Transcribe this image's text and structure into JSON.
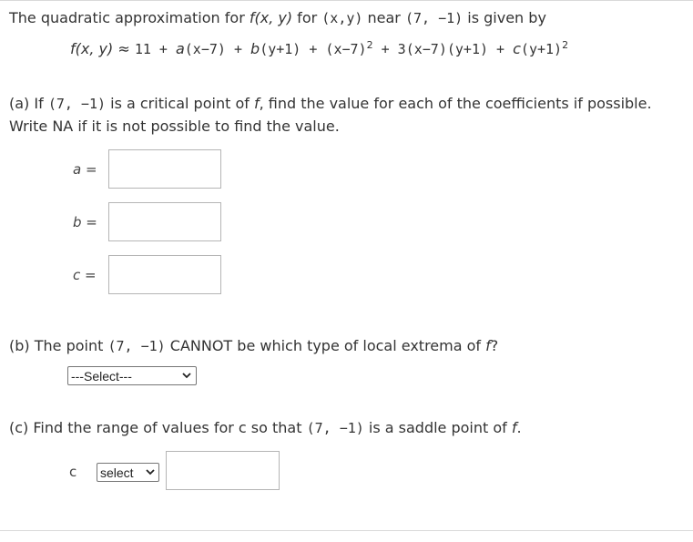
{
  "intro": {
    "text_before_func": "The quadratic approximation for ",
    "func": "f(x, y)",
    "for": " for ",
    "vars": "(x,y)",
    "near": " near ",
    "point": "(7, −1)",
    "after": " is given by"
  },
  "formula": {
    "lhs": "f(x, y)",
    "approx": " ≈ ",
    "p1": "11 + ",
    "a": "a",
    "p2": "(x−7) + ",
    "b": "b",
    "p3": "(y+1) + (x−7)",
    "exp1": "2",
    "p4": " + 3(x−7)(y+1) + ",
    "c": "c",
    "p5": "(y+1)",
    "exp2": "2"
  },
  "part_a": {
    "prefix": "(a) If ",
    "point": "(7, −1)",
    "mid": " is a critical point of ",
    "f": "f",
    "suffix": ", find the value for each of the coefficients if possible.",
    "line2": "Write NA if it is not possible to find the value.",
    "a_label": "a =",
    "b_label": "b =",
    "c_label": "c =",
    "a_value": "",
    "b_value": "",
    "c_value": ""
  },
  "part_b": {
    "prefix": "(b) The point ",
    "point": "(7, −1)",
    "mid": " CANNOT be which type of local extrema of ",
    "f": "f",
    "suffix": "?",
    "select_value": "---Select---"
  },
  "part_c": {
    "prefix": "(c) Find the range of values for ",
    "c": "c",
    "mid": " so that ",
    "point": "(7, −1)",
    "mid2": " is a saddle point of ",
    "f": "f",
    "suffix": ".",
    "var_label": "c",
    "select_value": "select",
    "input_value": ""
  },
  "icons": {
    "dropdown": "chevron-down-icon"
  }
}
